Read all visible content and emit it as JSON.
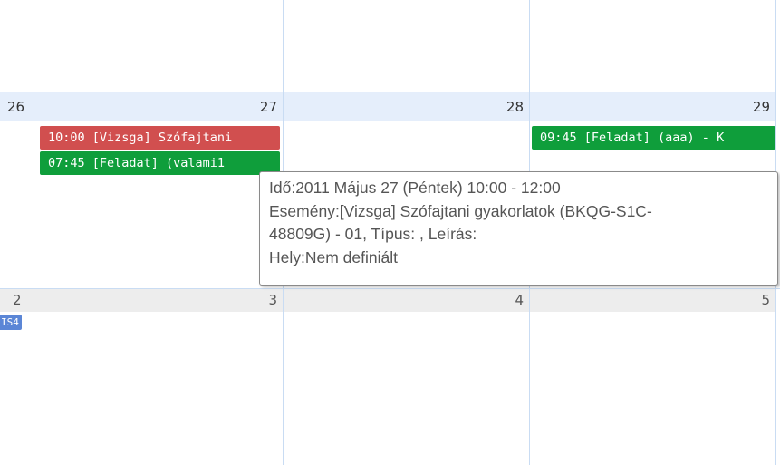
{
  "calendar": {
    "week1": {
      "days": [
        "26",
        "27",
        "28",
        "29"
      ]
    },
    "week2": {
      "days": [
        "2",
        "3",
        "4",
        "5"
      ]
    },
    "events": [
      {
        "text": "10:00 [Vizsga] Szófajtani",
        "color": "#d14f4f"
      },
      {
        "text": "07:45 [Feladat] (valami1",
        "color": "#0f9e3b"
      },
      {
        "text": "09:45 [Feladat] (aaa) - K",
        "color": "#0f9e3b"
      },
      {
        "text": "IS4",
        "color": "#5b86d6"
      }
    ]
  },
  "tooltip": {
    "lines": [
      "Idő:2011 Május 27 (Péntek) 10:00 -  12:00",
      "Esemény:[Vizsga] Szófajtani gyakorlatok (BKQG-S1C-",
      "48809G)  - 01, Típus: , Leírás:",
      "Hely:Nem definiált"
    ]
  },
  "colors": {
    "grid": "#c9dcf3",
    "header_current": "#e5eefb",
    "header_next": "#ededed"
  }
}
